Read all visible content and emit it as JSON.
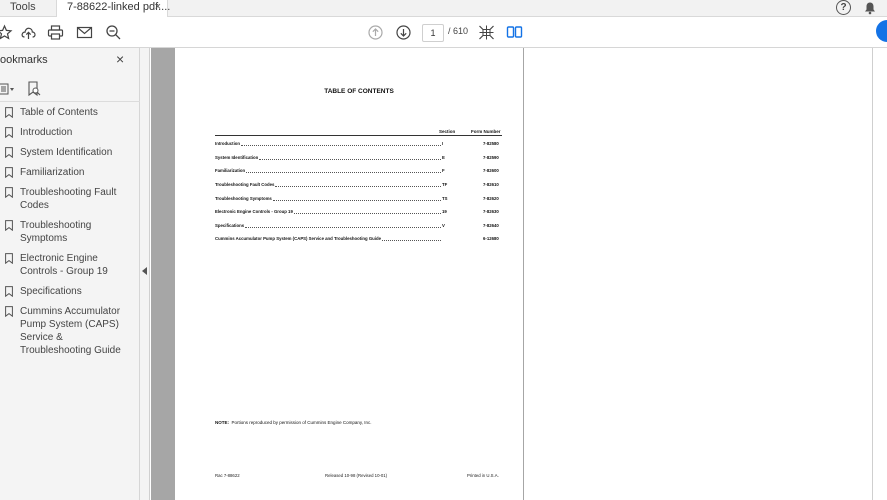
{
  "tabs": {
    "tools_label": "Tools",
    "doc_label": "7-88622-linked pdf....",
    "close_glyph": "×"
  },
  "header_icons": {
    "help": "?",
    "help_icon": "help-icon",
    "bell_icon": "bell-icon"
  },
  "toolbar": {
    "icons": [
      "star-icon",
      "upload-icon",
      "print-icon",
      "email-icon",
      "zoom-out-icon",
      "page-up-icon",
      "page-down-icon",
      "fit-page-icon",
      "two-page-icon"
    ],
    "current_page": "1",
    "page_total": "/ 610",
    "accent": "#1473e6"
  },
  "bookmarks": {
    "title": "ookmarks",
    "close_glyph": "×",
    "items": [
      "Table of Contents",
      "Introduction",
      "System Identification",
      "Familiarization",
      "Troubleshooting Fault Codes",
      "Troubleshooting Symptoms",
      "Electronic Engine Controls - Group 19",
      "Specifications",
      "Cummins Accumulator Pump System (CAPS) Service & Troubleshooting Guide"
    ]
  },
  "document": {
    "title": "TABLE OF CONTENTS",
    "col_section": "Section",
    "col_form": "Form Number",
    "rows": [
      {
        "name": "Introduction",
        "section": "I",
        "form": "7-82580"
      },
      {
        "name": "System Identification",
        "section": "E",
        "form": "7-82590"
      },
      {
        "name": "Familiarization",
        "section": "F",
        "form": "7-82600"
      },
      {
        "name": "Troubleshooting Fault Codes",
        "section": "TF",
        "form": "7-82610"
      },
      {
        "name": "Troubleshooting Symptoms",
        "section": "TS",
        "form": "7-82620"
      },
      {
        "name": "Electronic Engine Controls - Group 19",
        "section": "19",
        "form": "7-82630"
      },
      {
        "name": "Specifications",
        "section": "V",
        "form": "7-82640"
      },
      {
        "name": "Cummins Accumulator Pump System (CAPS) Service and Troubleshooting Guide",
        "section": "",
        "form": "6-12680"
      }
    ],
    "note_label": "NOTE:",
    "note_text": "Portions reproduced by permission of Cummins Engine Company, Inc.",
    "footer_left": "Rac 7-88622",
    "footer_center": "Released 10-98 (Revised 10-01)",
    "footer_right": "Printed in U.S.A."
  }
}
